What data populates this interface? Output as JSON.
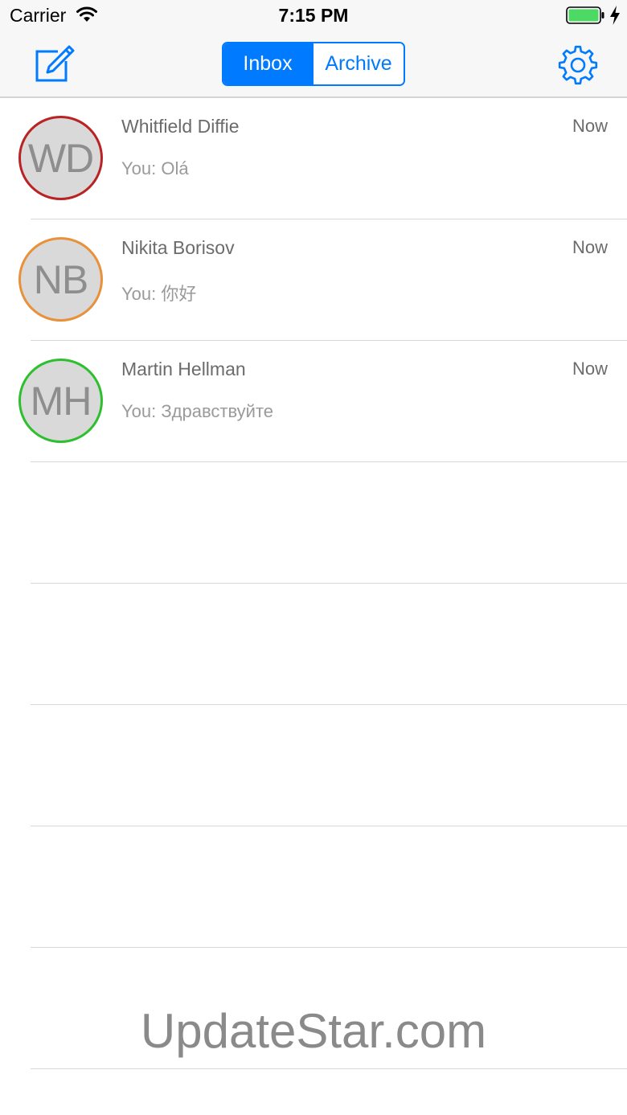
{
  "status_bar": {
    "carrier": "Carrier",
    "time": "7:15 PM",
    "wifi_icon": "wifi-icon",
    "battery_icon": "battery-icon",
    "charging_icon": "lightning-bolt-icon",
    "battery_color": "#4cd964"
  },
  "nav": {
    "compose_icon": "compose-icon",
    "settings_icon": "gear-icon",
    "segments": [
      {
        "label": "Inbox",
        "selected": true
      },
      {
        "label": "Archive",
        "selected": false
      }
    ],
    "accent_color": "#007aff"
  },
  "conversations": [
    {
      "initials": "WD",
      "name": "Whitfield Diffie",
      "time": "Now",
      "snippet": "You: Olá",
      "ring_color": "#b92323"
    },
    {
      "initials": "NB",
      "name": "Nikita Borisov",
      "time": "Now",
      "snippet": "You: 你好",
      "ring_color": "#e8913a"
    },
    {
      "initials": "MH",
      "name": "Martin Hellman",
      "time": "Now",
      "snippet": "You: Здравствуйте",
      "ring_color": "#2ebf2e"
    }
  ],
  "watermark": "UpdateStar.com"
}
